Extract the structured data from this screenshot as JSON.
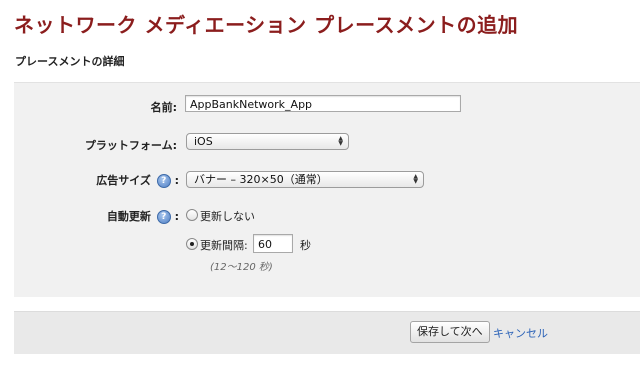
{
  "page": {
    "title": "ネットワーク メディエーション プレースメントの追加",
    "section_title": "プレースメントの詳細"
  },
  "form": {
    "name": {
      "label": "名前:",
      "value": "AppBankNetwork_App"
    },
    "platform": {
      "label": "プラットフォーム:",
      "selected": "iOS"
    },
    "ad_size": {
      "label": "広告サイズ",
      "colon": ":",
      "selected": "バナー – 320×50（通常）"
    },
    "auto_refresh": {
      "label": "自動更新",
      "colon": ":",
      "options": [
        {
          "label": "更新しない",
          "checked": false
        },
        {
          "label": "更新間隔:",
          "checked": true
        }
      ],
      "interval_value": "60",
      "unit": "秒",
      "hint": "(12〜120 秒)"
    },
    "help_icon": "help-icon"
  },
  "footer": {
    "save_label": "保存して次へ",
    "cancel_label": "キャンセル"
  },
  "colors": {
    "title": "#8b1d1d",
    "link": "#2c63b8",
    "panel": "#f1f1f1"
  }
}
